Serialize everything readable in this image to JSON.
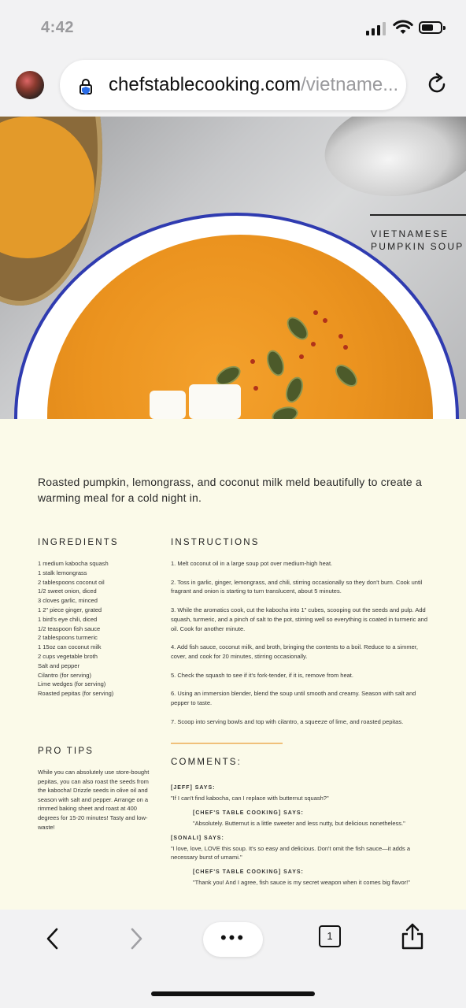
{
  "status_bar": {
    "time": "4:42"
  },
  "browser": {
    "url_domain": "chefstablecooking.com",
    "url_path": "/vietname..."
  },
  "hero": {
    "title_line1": "VIETNAMESE",
    "title_line2": "PUMPKIN SOUP"
  },
  "intro": "Roasted pumpkin, lemongrass, and coconut milk meld beautifully to create a warming meal for a cold night in.",
  "ingredients": {
    "heading": "INGREDIENTS",
    "items": [
      "1 medium kabocha squash",
      "1 stalk lemongrass",
      "2 tablespoons coconut oil",
      "1/2 sweet onion, diced",
      "3 cloves garlic, minced",
      "1 2\" piece ginger, grated",
      "1 bird's eye chili, diced",
      "1/2 teaspoon fish sauce",
      "2 tablespoons turmeric",
      "1 15oz can coconut milk",
      "2 cups vegetable broth",
      "Salt and pepper",
      "Cilantro (for serving)",
      "Lime wedges (for serving)",
      "Roasted pepitas (for serving)"
    ]
  },
  "instructions": {
    "heading": "INSTRUCTIONS",
    "steps": [
      "1. Melt coconut oil in a large soup pot over medium-high heat.",
      "2. Toss in garlic, ginger, lemongrass, and chili, stirring occasionally so they don't burn. Cook until fragrant and onion is starting to turn translucent, about 5 minutes.",
      "3. While the aromatics cook, cut the kabocha into 1\" cubes, scooping out the seeds and pulp. Add squash, turmeric, and a pinch of salt to the pot, stirring well so everything is coated in turmeric and oil. Cook for another minute.",
      "4. Add fish sauce, coconut milk, and broth, bringing the contents to a boil. Reduce to a simmer, cover, and cook for 20 minutes, stirring occasionally.",
      "5. Check the squash to see if it's fork-tender, if it is, remove from heat.",
      "6. Using an immersion blender, blend the soup until smooth and creamy. Season with salt and pepper to taste.",
      "7. Scoop into serving bowls and top with cilantro, a squeeze of lime, and roasted pepitas."
    ]
  },
  "pro_tips": {
    "heading": "PRO TIPS",
    "text": "While you can absolutely use store-bought pepitas, you can also roast the seeds from the kabocha! Drizzle seeds in olive oil and season with salt and pepper. Arrange on a rimmed baking sheet and roast at 400 degrees for 15-20 minutes! Tasty and low-waste!"
  },
  "comments": {
    "heading": "COMMENTS:",
    "items": [
      {
        "name": "[JEFF] SAYS:",
        "text": "\"If I can't find kabocha, can I replace with butternut squash?\""
      },
      {
        "name": "[CHEF'S TABLE COOKING] SAYS:",
        "text": "\"Absolutely. Butternut is a little sweeter and less nutty, but delicious nonetheless.\""
      },
      {
        "name": "[SONALI] SAYS:",
        "text": "\"I love, love, LOVE this soup. It's so easy and delicious. Don't omit the fish sauce—it adds a necessary burst of umami.\""
      },
      {
        "name": "[CHEF'S TABLE COOKING] SAYS:",
        "text": "\"Thank you! And I agree, fish sauce is my secret weapon when it comes big flavor!\""
      }
    ]
  },
  "toolbar": {
    "menu_label": "•••",
    "tab_count": "1"
  }
}
